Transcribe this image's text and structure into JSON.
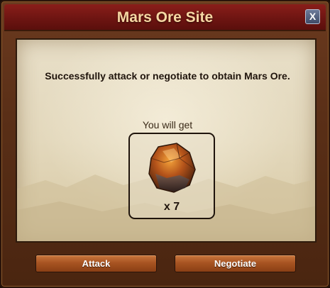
{
  "dialog": {
    "title": "Mars Ore Site",
    "close_label": "X"
  },
  "content": {
    "message": "Successfully attack or negotiate to obtain Mars Ore.",
    "reward_label": "You will get",
    "reward": {
      "icon": "mars-ore-icon",
      "quantity": "x 7"
    }
  },
  "actions": {
    "attack_label": "Attack",
    "negotiate_label": "Negotiate"
  },
  "colors": {
    "title_bar": "#7a1a16",
    "title_text": "#f6d7a3",
    "frame": "#5a2f17",
    "parchment": "#e3d8bc",
    "button": "#a85422"
  }
}
